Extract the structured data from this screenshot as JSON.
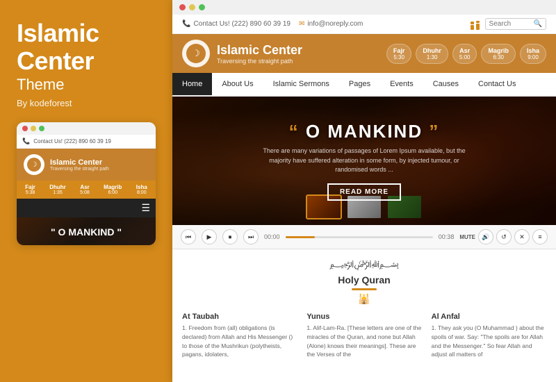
{
  "left": {
    "title": "Islamic\nCenter",
    "subtitle": "Theme",
    "by": "By kodeforest"
  },
  "mobile": {
    "dots": [
      "red",
      "yellow",
      "green"
    ],
    "contact": "Contact Us! (222) 890 60 39 19",
    "site_title": "Islamic Center",
    "site_tagline": "Traversing the straight path",
    "prayer_times": [
      {
        "name": "Fajr",
        "time": "5:38"
      },
      {
        "name": "Dhuhr",
        "time": "1:35"
      },
      {
        "name": "Asr",
        "time": "5:08"
      },
      {
        "name": "Magrib",
        "time": "6:00"
      },
      {
        "name": "Isha",
        "time": "8:00"
      }
    ],
    "hero_title": "\" O MANKIND \""
  },
  "browser": {
    "topbar": {
      "contact_phone": "Contact Us! (222) 890 60 39 19",
      "email": "info@noreply.com",
      "search_placeholder": "Search"
    },
    "header": {
      "site_title": "Islamic Center",
      "site_tagline": "Traversing the straight path",
      "prayer_times": [
        {
          "name": "Fajr",
          "time": "5:30"
        },
        {
          "name": "Dhuhr",
          "time": "1:30"
        },
        {
          "name": "Asr",
          "time": "5:00"
        },
        {
          "name": "Magrib",
          "time": "6:30"
        },
        {
          "name": "Isha",
          "time": "9:00"
        }
      ]
    },
    "nav": {
      "items": [
        "Home",
        "About Us",
        "Islamic Sermons",
        "Pages",
        "Events",
        "Causes",
        "Contact Us"
      ],
      "active": "Home"
    },
    "hero": {
      "quote_open": "\"",
      "title": "O MANKIND",
      "quote_close": "\"",
      "text": "There are many variations of passages of Lorem Ipsum available, but the majority have suffered alteration in some form, by injected tumour, or randomised words ...",
      "read_more": "READ MORE"
    },
    "audio_player": {
      "time_start": "00:00",
      "time_end": "00:38",
      "mute_label": "MUTE"
    },
    "content": {
      "arabic_text": "﷽",
      "section_title": "Holy Quran",
      "columns": [
        {
          "title": "At Taubah",
          "text": "1. Freedom from (all) obligations (is declared) from Allah and His Messenger () to those of the Mushrikun (polytheists, pagans, idolaters,"
        },
        {
          "title": "Yunus",
          "text": "1. Alif-Lam-Ra. [These letters are one of the miracles of the Quran, and none but Allah (Alone) knows their meanings]. These are the Verses of the"
        },
        {
          "title": "Al Anfal",
          "text": "1. They ask you (O Muhammad ) about the spoils of war. Say: \"The spoils are for Allah and the Messenger.\" So fear Allah and adjust all matters of"
        }
      ]
    }
  }
}
